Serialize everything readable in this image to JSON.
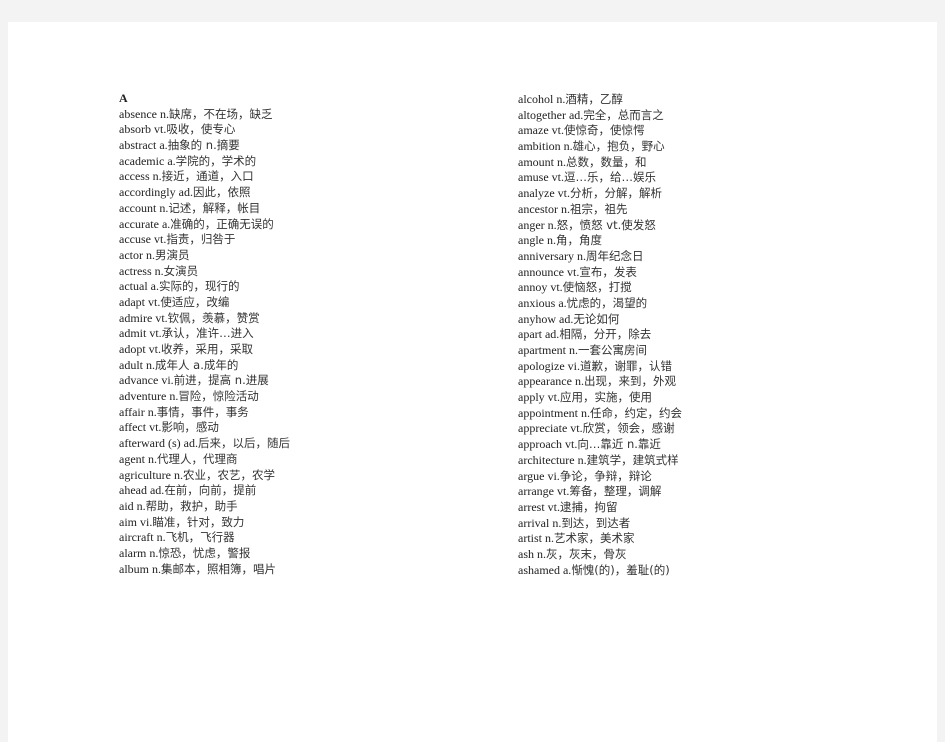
{
  "left_column": {
    "heading": "A",
    "entries": [
      [
        "absence",
        "n.",
        "缺席，不在场，缺乏"
      ],
      [
        "absorb",
        "vt.",
        "吸收，使专心"
      ],
      [
        "abstract",
        "a.",
        "抽象的 n.摘要"
      ],
      [
        "academic",
        "a.",
        "学院的，学术的"
      ],
      [
        "access",
        "n.",
        "接近，通道，入口"
      ],
      [
        "accordingly",
        "ad.",
        "因此，依照"
      ],
      [
        "account",
        "n.",
        "记述，解释，帐目"
      ],
      [
        "accurate",
        "a.",
        "准确的，正确无误的"
      ],
      [
        "accuse",
        "vt.",
        "指责，归咎于"
      ],
      [
        "actor",
        "n.",
        "男演员"
      ],
      [
        "actress",
        "n.",
        "女演员"
      ],
      [
        "actual",
        "a.",
        "实际的，现行的"
      ],
      [
        "adapt",
        "vt.",
        "使适应，改编"
      ],
      [
        "admire",
        "vt.",
        "钦佩，羡慕，赞赏"
      ],
      [
        "admit",
        "vt.",
        "承认，准许…进入"
      ],
      [
        "adopt",
        "vt.",
        "收养，采用，采取"
      ],
      [
        "adult",
        "n.",
        "成年人 a.成年的"
      ],
      [
        "advance",
        "vi.",
        "前进，提高 n.进展"
      ],
      [
        "adventure",
        "n.",
        "冒险，惊险活动"
      ],
      [
        "affair",
        "n.",
        "事情，事件，事务"
      ],
      [
        "affect",
        "vt.",
        "影响，感动"
      ],
      [
        "afterward (s)",
        "ad.",
        "后来，以后，随后"
      ],
      [
        "agent",
        "n.",
        "代理人，代理商"
      ],
      [
        "agriculture",
        "n.",
        "农业，农艺，农学"
      ],
      [
        "ahead",
        "ad.",
        "在前，向前，提前"
      ],
      [
        "aid",
        "n.",
        "帮助，救护，助手"
      ],
      [
        "aim",
        "vi.",
        "瞄准，针对，致力"
      ],
      [
        "aircraft",
        "n.",
        "飞机，飞行器"
      ],
      [
        "alarm",
        "n.",
        "惊恐，忧虑，警报"
      ],
      [
        "album",
        "n.",
        "集邮本，照相簿，唱片"
      ]
    ]
  },
  "right_column": {
    "entries": [
      [
        "alcohol",
        "n.",
        "酒精，乙醇"
      ],
      [
        "altogether",
        "ad.",
        "完全，总而言之"
      ],
      [
        "amaze",
        "vt.",
        "使惊奇，使惊愕"
      ],
      [
        "ambition",
        "n.",
        "雄心，抱负，野心"
      ],
      [
        "amount",
        "n.",
        "总数，数量，和"
      ],
      [
        "amuse",
        "vt.",
        "逗…乐，给…娱乐"
      ],
      [
        "analyze",
        "vt.",
        "分析，分解，解析"
      ],
      [
        "ancestor",
        "n.",
        "祖宗，祖先"
      ],
      [
        "anger",
        "n.",
        "怒，愤怒 vt.使发怒"
      ],
      [
        "angle",
        "n.",
        "角，角度"
      ],
      [
        "anniversary",
        "n.",
        "周年纪念日"
      ],
      [
        "announce",
        "vt.",
        "宣布，发表"
      ],
      [
        "annoy",
        "vt.",
        "使恼怒，打搅"
      ],
      [
        "anxious",
        "a.",
        "忧虑的，渴望的"
      ],
      [
        "anyhow",
        "ad.",
        "无论如何"
      ],
      [
        "apart",
        "ad.",
        "相隔，分开，除去"
      ],
      [
        "apartment",
        "n.",
        "一套公寓房间"
      ],
      [
        "apologize",
        "vi.",
        "道歉，谢罪，认错"
      ],
      [
        "appearance",
        "n.",
        "出现，来到，外观"
      ],
      [
        "apply",
        "vt.",
        "应用，实施，使用"
      ],
      [
        "appointment",
        "n.",
        "任命，约定，约会"
      ],
      [
        "appreciate",
        "vt.",
        "欣赏，领会，感谢"
      ],
      [
        "approach",
        "vt.",
        "向…靠近 n.靠近"
      ],
      [
        "architecture",
        "n.",
        "建筑学，建筑式样"
      ],
      [
        "argue",
        "vi.",
        "争论，争辩，辩论"
      ],
      [
        "arrange",
        "vt.",
        "筹备，整理，调解"
      ],
      [
        "arrest",
        "vt.",
        "逮捕，拘留"
      ],
      [
        "arrival",
        "n.",
        "到达，到达者"
      ],
      [
        "artist",
        "n.",
        "艺术家，美术家"
      ],
      [
        "ash",
        "n.",
        "灰，灰末，骨灰"
      ],
      [
        "ashamed",
        "a.",
        "惭愧(的)，羞耻(的)"
      ]
    ]
  }
}
